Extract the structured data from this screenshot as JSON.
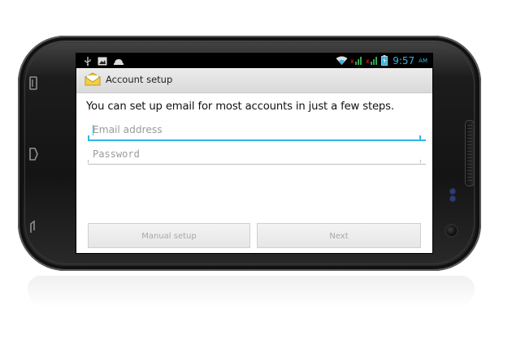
{
  "status_bar": {
    "time": "9:57",
    "ampm": "AM",
    "icons_left": [
      "usb-icon",
      "screenshot-icon",
      "android-debug-icon"
    ],
    "icons_right": [
      "wifi-icon",
      "signal-icon",
      "signal-icon-2",
      "battery-icon"
    ],
    "time_color": "#33b5e5"
  },
  "header": {
    "title": "Account setup",
    "icon": "email-app-icon"
  },
  "main": {
    "intro": "You can set up email for most accounts in just a few steps.",
    "email": {
      "placeholder": "Email address",
      "value": ""
    },
    "password": {
      "placeholder": "Password",
      "value": ""
    },
    "manual_setup_label": "Manual setup",
    "next_label": "Next"
  },
  "device": {
    "hardware_keys": [
      "menu-key-icon",
      "search-key-icon",
      "back-key-icon"
    ]
  },
  "colors": {
    "accent": "#33b5e5",
    "title_bar": "#e2e2e2",
    "button_text_disabled": "#a8a8a8"
  }
}
